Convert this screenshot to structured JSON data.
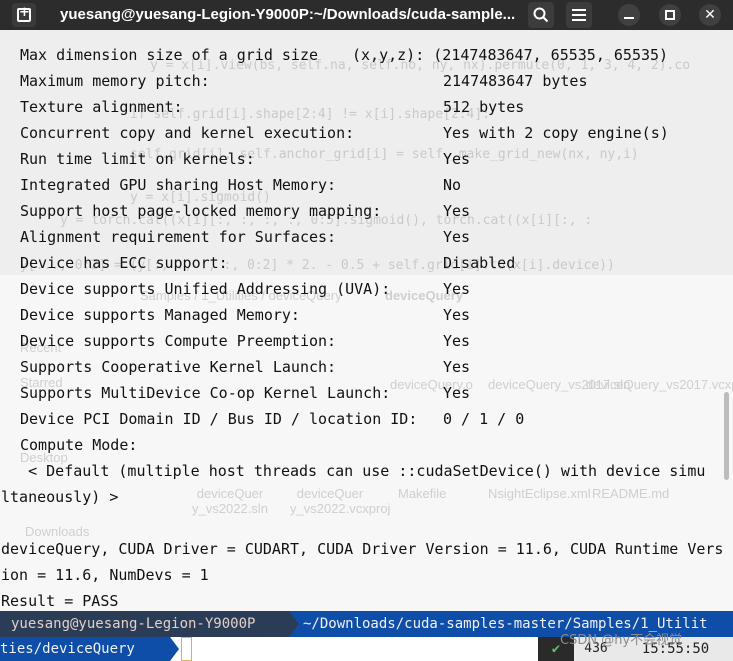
{
  "window": {
    "title": "yuesang@yuesang-Legion-Y9000P:~/Downloads/cuda-sample..."
  },
  "terminal_lines": [
    {
      "key": "Max dimension size of a grid size",
      "val": "(x,y,z): (2147483647, 65535, 65535)"
    },
    {
      "key": "Maximum memory pitch:",
      "val": "2147483647 bytes"
    },
    {
      "key": "Texture alignment:",
      "val": "512 bytes"
    },
    {
      "key": "Concurrent copy and kernel execution:",
      "val": "Yes with 2 copy engine(s)"
    },
    {
      "key": "Run time limit on kernels:",
      "val": "Yes"
    },
    {
      "key": "Integrated GPU sharing Host Memory:",
      "val": "No"
    },
    {
      "key": "Support host page-locked memory mapping:",
      "val": "Yes"
    },
    {
      "key": "Alignment requirement for Surfaces:",
      "val": "Yes"
    },
    {
      "key": "Device has ECC support:",
      "val": "Disabled"
    },
    {
      "key": "Device supports Unified Addressing (UVA):",
      "val": "Yes"
    },
    {
      "key": "Device supports Managed Memory:",
      "val": "Yes"
    },
    {
      "key": "Device supports Compute Preemption:",
      "val": "Yes"
    },
    {
      "key": "Supports Cooperative Kernel Launch:",
      "val": "Yes"
    },
    {
      "key": "Supports MultiDevice Co-op Kernel Launch:",
      "val": "Yes"
    },
    {
      "key": "Device PCI Domain ID / Bus ID / location ID:",
      "val": "0 / 1 / 0"
    },
    {
      "key": "Compute Mode:",
      "val": ""
    }
  ],
  "compute_mode_line1": "   < Default (multiple host threads can use ::cudaSetDevice() with device simu",
  "compute_mode_line2": "ltaneously) >",
  "summary_line1": "deviceQuery, CUDA Driver = CUDART, CUDA Driver Version = 11.6, CUDA Runtime Vers",
  "summary_line2": "ion = 11.6, NumDevs = 1",
  "result_line": "Result = PASS",
  "prompt": {
    "user_host": "yuesang@yuesang-Legion-Y9000P",
    "path": "~/Downloads/cuda-samples-master/Samples/1_Utilit",
    "path_wrap": "ties/deviceQuery"
  },
  "status": {
    "check": "✔",
    "number": "436",
    "time": "15:55:50"
  },
  "watermark": "CSDN @hy不会视觉",
  "ghost": {
    "code": [
      "        y = x[i].view(bs, self.na, self.no, ny, nx).permute(0, 1, 3, 4, 2).co",
      "            if self.grid[i].shape[2:4] != x[i].shape[2:4]:",
      "                self.grid[i], self.anchor_grid[i] = self._make_grid_new(nx, ny,i)",
      "            y = x[i].sigmoid()",
      "            y = torch.cat((x[i][:, :, :, :, 0:5].sigmoid(), torch.cat((x[i][:, :",
      "            y[..., 0:2] = (y[:, :, :, :, 0:2] * 2. - 0.5 + self.grid[i].to(x[i].device))"
    ],
    "files": [
      "deviceQuery.o",
      "deviceQuery_vs2017.sln",
      "deviceQuery_vs2017.vcxproj",
      "deviceQuer y_vs2022.sln",
      "deviceQuer y_vs2022.vcxproj",
      "Makefile",
      "NsightEclipse.xml",
      "README.md"
    ],
    "breadcrumb": "Samples / 1_Utilities / deviceQuery",
    "search_label": "deviceQuery",
    "sidebar": [
      "Recent",
      "Starred",
      "Home",
      "Desktop",
      "Downloads"
    ]
  }
}
